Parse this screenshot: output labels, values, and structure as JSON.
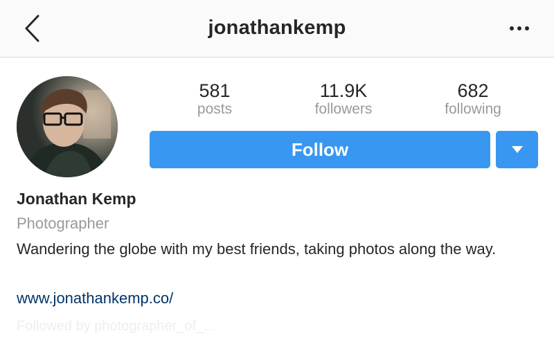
{
  "nav": {
    "title": "jonathankemp"
  },
  "stats": [
    {
      "value": "581",
      "label": "posts"
    },
    {
      "value": "11.9K",
      "label": "followers"
    },
    {
      "value": "682",
      "label": "following"
    }
  ],
  "actions": {
    "follow_label": "Follow"
  },
  "profile": {
    "name": "Jonathan Kemp",
    "category": "Photographer",
    "bio": "Wandering the globe with my best friends, taking photos along the way.",
    "website": "www.jonathankemp.co/",
    "faded_line": "Followed by photographer_of_..."
  },
  "colors": {
    "accent": "#3897f0",
    "link": "#003569",
    "muted": "#999999"
  }
}
